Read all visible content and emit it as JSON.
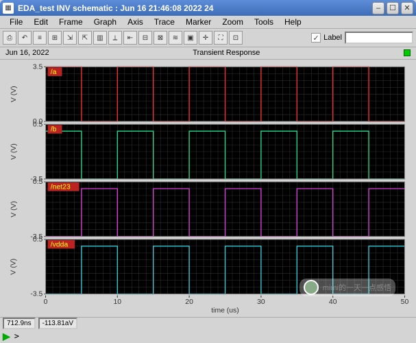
{
  "window": {
    "title": "EDA_test INV schematic : Jun 16 21:46:08 2022 24"
  },
  "menu": [
    "File",
    "Edit",
    "Frame",
    "Graph",
    "Axis",
    "Trace",
    "Marker",
    "Zoom",
    "Tools",
    "Help"
  ],
  "toolbar": {
    "icons": [
      "print-icon",
      "undo-icon",
      "grid-lines-icon",
      "grid-dots-icon",
      "export-icon",
      "import-icon",
      "graph-icon",
      "ruler-icon",
      "arrow-left-icon",
      "tool-a-icon",
      "tool-b-icon",
      "ruler2-icon",
      "zoom-full-icon",
      "crosshair-icon",
      "maximize-icon",
      "fit-icon"
    ],
    "label_text": "Label",
    "label_value": ""
  },
  "info": {
    "date": "Jun 16, 2022",
    "title": "Transient Response"
  },
  "chart_data": {
    "type": "line",
    "xlabel": "time (us)",
    "x_range": [
      0,
      50
    ],
    "x_ticks": [
      0,
      10,
      20,
      30,
      40,
      50
    ],
    "subplots": [
      {
        "name": "/a",
        "color": "#ff3030",
        "ylabel": "V (V)",
        "ylim": [
          0.0,
          3.5
        ],
        "y_ticks": [
          0.0,
          3.5
        ],
        "transitions": [
          {
            "t": 0.0,
            "v": 3.5
          },
          {
            "t": 5.0,
            "v": 0.0
          },
          {
            "t": 10.0,
            "v": 3.5
          },
          {
            "t": 15.0,
            "v": 0.0
          },
          {
            "t": 20.0,
            "v": 3.5
          },
          {
            "t": 25.0,
            "v": 0.0
          },
          {
            "t": 30.0,
            "v": 3.5
          },
          {
            "t": 35.0,
            "v": 0.0
          },
          {
            "t": 40.0,
            "v": 3.5
          },
          {
            "t": 45.0,
            "v": 0.0
          },
          {
            "t": 50.0,
            "v": 0.0
          }
        ]
      },
      {
        "name": "/b",
        "color": "#20e090",
        "ylabel": "V (V)",
        "ylim": [
          -3.5,
          0.5
        ],
        "y_ticks": [
          -3.5,
          0.5
        ],
        "transitions": [
          {
            "t": 0.0,
            "v": 0.0
          },
          {
            "t": 5.0,
            "v": -3.5
          },
          {
            "t": 10.0,
            "v": 0.0
          },
          {
            "t": 15.0,
            "v": -3.5
          },
          {
            "t": 20.0,
            "v": 0.0
          },
          {
            "t": 25.0,
            "v": -3.5
          },
          {
            "t": 30.0,
            "v": 0.0
          },
          {
            "t": 35.0,
            "v": -3.5
          },
          {
            "t": 40.0,
            "v": 0.0
          },
          {
            "t": 45.0,
            "v": -3.5
          },
          {
            "t": 50.0,
            "v": -3.5
          }
        ]
      },
      {
        "name": "/net23",
        "color": "#e040e0",
        "ylabel": "V (V)",
        "ylim": [
          -3.5,
          0.5
        ],
        "y_ticks": [
          -3.5,
          0.5
        ],
        "transitions": [
          {
            "t": 0.0,
            "v": -3.5
          },
          {
            "t": 5.0,
            "v": 0.0
          },
          {
            "t": 10.0,
            "v": -3.5
          },
          {
            "t": 15.0,
            "v": 0.0
          },
          {
            "t": 20.0,
            "v": -3.5
          },
          {
            "t": 25.0,
            "v": 0.0
          },
          {
            "t": 30.0,
            "v": -3.5
          },
          {
            "t": 35.0,
            "v": 0.0
          },
          {
            "t": 40.0,
            "v": -3.5
          },
          {
            "t": 45.0,
            "v": 0.0
          },
          {
            "t": 50.0,
            "v": 0.0
          }
        ]
      },
      {
        "name": "/vdda",
        "color": "#30d0e0",
        "ylabel": "V (V)",
        "ylim": [
          -3.5,
          0.5
        ],
        "y_ticks": [
          -3.5,
          0.5
        ],
        "transitions": [
          {
            "t": 0.0,
            "v": -3.5
          },
          {
            "t": 5.0,
            "v": 0.0
          },
          {
            "t": 10.0,
            "v": -3.5
          },
          {
            "t": 15.0,
            "v": 0.0
          },
          {
            "t": 20.0,
            "v": -3.5
          },
          {
            "t": 25.0,
            "v": 0.0
          },
          {
            "t": 30.0,
            "v": -3.5
          },
          {
            "t": 35.0,
            "v": 0.0
          },
          {
            "t": 40.0,
            "v": -3.5
          },
          {
            "t": 45.0,
            "v": 0.0
          },
          {
            "t": 50.0,
            "v": 0.0
          }
        ]
      }
    ]
  },
  "footer": {
    "coord_x": "712.9ns",
    "coord_y": "-113.81aV"
  },
  "command": {
    "prompt": ">"
  },
  "watermark": "mimi的一天一点感悟"
}
